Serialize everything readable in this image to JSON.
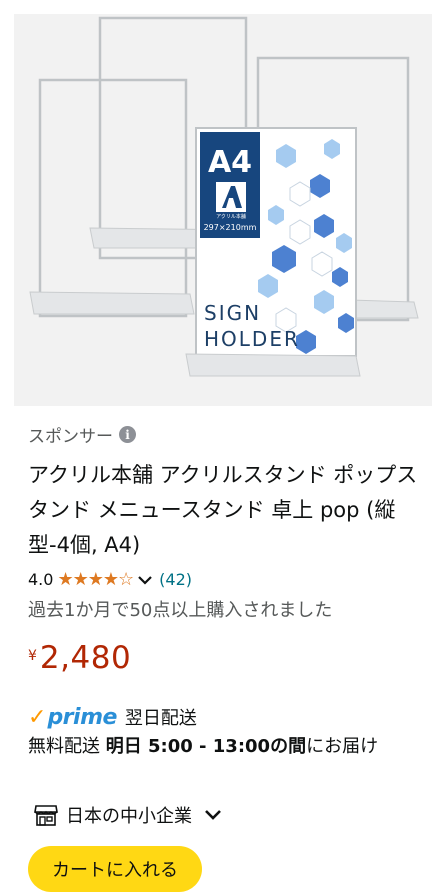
{
  "product": {
    "image_text": {
      "size": "A4",
      "brand_badge": "アクリル本舗",
      "dimensions": "297×210mm",
      "sign_line1": "SIGN",
      "sign_line2": "HOLDER"
    },
    "sponsored_label": "スポンサー",
    "info_glyph": "i",
    "title": "アクリル本舗 アクリルスタンド ポップスタンド メニュースタンド 卓上 pop (縦型-4個, A4)",
    "rating": {
      "value": "4.0",
      "stars": "★★★★☆",
      "stars_numeric": 4.0,
      "max": 5,
      "chevron": "✓",
      "review_count": "(42)"
    },
    "bought_text": "過去1か月で50点以上購入されました",
    "price": {
      "symbol": "¥",
      "amount": "2,480"
    },
    "prime": {
      "check": "✓",
      "word": "prime",
      "delivery": "翌日配送"
    },
    "shipping": {
      "prefix": "無料配送 ",
      "bold": "明日 5:00 - 13:00の間",
      "suffix": "にお届け"
    },
    "badge": {
      "label": "日本の中小企業",
      "icon": "store-icon"
    },
    "cart_button_label": "カートに入れる"
  },
  "colors": {
    "price": "#b12704",
    "star": "#de7921",
    "link": "#007185",
    "prime_blue": "#2a8fd7",
    "prime_check": "#ff9900",
    "cart_button": "#ffd814",
    "image_bg": "#f2f2f2",
    "sign_blue": "#1a4f8f"
  }
}
